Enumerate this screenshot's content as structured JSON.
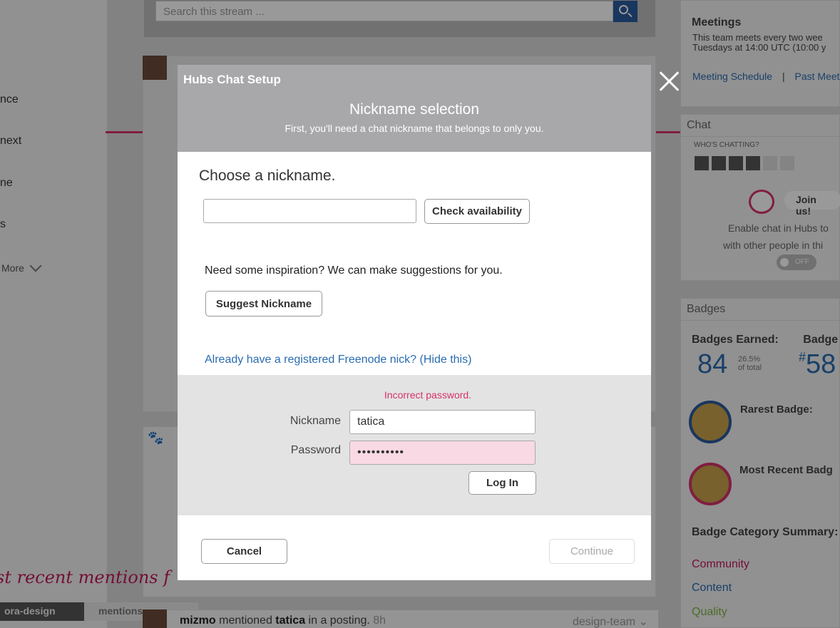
{
  "background": {
    "search_placeholder": "Search this stream ...",
    "left_nav": [
      "nce",
      "next",
      "ne",
      "s"
    ],
    "more_label": "More",
    "mentions_title": "st recent mentions f",
    "tabs": [
      "ora-design",
      "mentions"
    ],
    "activity": {
      "user": "mizmo",
      "verb": "mentioned",
      "target": "tatica",
      "rest": "in a posting.",
      "time": "8h",
      "tag": "design-team"
    },
    "right": {
      "meetings_title": "Meetings",
      "meetings_text_1": "This team meets every two wee",
      "meetings_text_2": "Tuesdays at 14:00 UTC (10:00 y",
      "meeting_schedule": "Meeting Schedule",
      "separator": "|",
      "past_meetings": "Past Meet",
      "chat_title": "Chat",
      "whos_chatting": "WHO'S CHATTING?",
      "join_us": "Join us!",
      "enable_text_1": "Enable chat in Hubs to",
      "enable_text_2": "with other people in thi",
      "toggle_label": "OFF",
      "badges_title": "Badges",
      "badges_earned_label": "Badges Earned:",
      "badge_rank_label": "Badge",
      "badges_earned_value": "84",
      "badges_pct": "26.5%",
      "badges_pct_label": "of total",
      "badge_rank_hash": "#",
      "badge_rank_value": "58",
      "rarest_label": "Rarest Badge:",
      "recent_label": "Most Recent Badg",
      "summary_label": "Badge Category Summary:",
      "categories": [
        {
          "name": "Community",
          "color": "#c2185b"
        },
        {
          "name": "Content",
          "color": "#2a6cb0"
        },
        {
          "name": "Quality",
          "color": "#7cb342"
        }
      ]
    }
  },
  "modal": {
    "app_title": "Hubs Chat Setup",
    "title": "Nickname selection",
    "subtitle": "First, you'll need a chat nickname that belongs to only you.",
    "choose_heading": "Choose a nickname.",
    "nickname_value": "",
    "check_button": "Check availability",
    "inspiration_text": "Need some inspiration? We can make suggestions for you.",
    "suggest_button": "Suggest Nickname",
    "registered_link": "Already have a registered Freenode nick? (Hide this)",
    "login": {
      "error": "Incorrect password.",
      "nickname_label": "Nickname",
      "nickname_value": "tatica",
      "password_label": "Password",
      "password_value": "••••••••••",
      "login_button": "Log In"
    },
    "cancel_button": "Cancel",
    "continue_button": "Continue"
  },
  "colors": {
    "accent_pink": "#d6336c",
    "link_blue": "#2a6cb0",
    "header_gray": "#a8a8aa"
  }
}
